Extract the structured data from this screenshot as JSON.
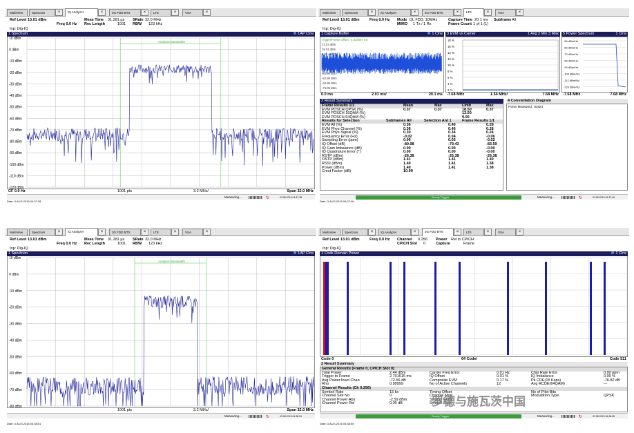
{
  "shots": [
    {
      "tabs": [
        "MultiView",
        "Spectrum",
        "IQ Analyzer",
        "3G FDD BTS",
        "LTE",
        "VSA"
      ],
      "params": {
        "ref_level": "Ref Level 13.01 dBm",
        "meas_time": "Meas Time",
        "meas_time_val": "31.281 µs",
        "srate": "SRate",
        "srate_val": "32.0 MHz",
        "freq": "Freq 0.0 Hz",
        "rec_length": "Rec Length",
        "rec_length_val": "1001",
        "rbw": "RBW",
        "rbw_val": "123 kHz",
        "inp": "Inp: Dig-IQ"
      },
      "window_title": "1 Spectrum",
      "window_flag": "1AP Clrw",
      "annotation": "Analysis Bandwidth",
      "yticks": [
        "10 dBm",
        "0 dBm",
        "-10 dBm",
        "-20 dBm",
        "-30 dBm",
        "-40 dBm",
        "-50 dBm",
        "-60 dBm",
        "-70 dBm",
        "-80 dBm",
        "-90 dBm",
        "-100 dBm",
        "-110 dBm",
        "-120 dBm"
      ],
      "bottom": {
        "left": "CF 0.0 Hz",
        "mid": "1001 pts",
        "mid2": "3.2 MHz/",
        "right": "Span 32.0 MHz"
      },
      "status": "Measuring...",
      "date": "Date: 3.AUG.2015  04:37:38",
      "clock": "03.08.2015 04:37:38"
    },
    {
      "tabs": [
        "MultiView",
        "Spectrum",
        "IQ Analyzer",
        "3G FDD BTS",
        "LTE",
        "VSA"
      ],
      "params": {
        "ref_level": "Ref Level 13.01 dBm",
        "freq": "Freq 0.0 Hz",
        "mode": "Mode",
        "mode_val": "DL FDD, 10MHz",
        "mimo": "MIMO",
        "mimo_val": "1 Tx / 1 Rx",
        "capture_time": "Capture Time",
        "capture_time_val": "20.1 ms",
        "frame_count": "Frame Count",
        "frame_count_val": "1 of 1 (1)",
        "subframe": "Subframe",
        "subframe_val": "All",
        "inp": "Inp: Dig-IQ"
      },
      "capture": {
        "title": "1 Capture Buffer",
        "flag": "1 Clrw",
        "ylabels": [
          "Trigger/Frame Offset: -1.333067 ms",
          "31.01 dBm",
          "19.01 dBm",
          "7.01 dBm",
          "-4.99 dBm",
          "-16.99 dBm",
          "-28.99 dBm",
          "-40.99 dBm",
          "-52.99 dBm",
          "-64.99 dBm",
          "-76.99 dBm"
        ],
        "x0": "0.0 ms",
        "x1": "2.01 ms/",
        "x2": "20.1 ms"
      },
      "evm": {
        "title": "3 EVM vs Carrier",
        "flag": "1 Avg  2 Min  3 Max",
        "ylabels": [
          "18 %",
          "16 %",
          "14 %",
          "12 %",
          "10 %",
          "8 %",
          "6 %",
          "4 %",
          "2 %"
        ],
        "x0": "-7.68 MHz",
        "x1": "1.54 MHz/",
        "x2": "7.68 MHz"
      },
      "ps": {
        "title": "5 Power Spectrum",
        "flag": "1 Clrw",
        "ylabels": [
          "-54 dBm/Hz",
          "-60 dBm/Hz",
          "-70 dBm/Hz",
          "-80 dBm/Hz",
          "-90 dBm/Hz",
          "-100 dBm/Hz",
          "-112 dBm/Hz",
          "-120 dBm/Hz"
        ],
        "x0": "-7.68 MHz",
        "x2": "7.68 MHz"
      },
      "summary": {
        "title": "2 Result Summary",
        "header": [
          "Frame Results 1/1",
          "Mean",
          "Max",
          "Limit",
          "Max"
        ],
        "rows1": [
          [
            "EVM PDSCH QPSK (%)",
            "0.37",
            "0.37",
            "18.50",
            "0.37"
          ],
          [
            "EVM PDSCH 16QAM (%)",
            "",
            "",
            "13.50",
            ""
          ],
          [
            "EVM PDSCH 64QAM (%)",
            "",
            "",
            "9.00",
            ""
          ]
        ],
        "header2": [
          "Results for Selection",
          "Subframes  All",
          "Selection  Ant 1",
          "Frame Results  1/1"
        ],
        "rows2": [
          [
            "EVM All (%)",
            "0.36",
            "0.40",
            "0.28"
          ],
          [
            "EVM Phys Channel (%)",
            "0.36",
            "0.40",
            "0.28"
          ],
          [
            "EVM Phys Signal (%)",
            "0.30",
            "0.34",
            "0.24"
          ],
          [
            "Frequency Error (Hz)",
            "-0.02",
            "0.04",
            "-0.06"
          ],
          [
            "Sampling Error (ppm)",
            "0.00",
            "0.03",
            "-0.02"
          ],
          [
            "IQ Offset (dB)",
            "-80.98",
            "-79.43",
            "-83.59"
          ],
          [
            "IQ Gain Imbalance (dB)",
            "0.00",
            "0.00",
            "-0.00"
          ],
          [
            "IQ Quadrature Error (°)",
            "0.00",
            "0.00",
            "-0.00"
          ],
          [
            "RSTP (dBm)",
            "-26.38",
            "-26.38",
            "-26.38"
          ],
          [
            "OSTP (dBm)",
            "1.41",
            "1.41",
            "1.40"
          ],
          [
            "RSSI (dBm)",
            "1.40",
            "1.41",
            "1.38"
          ],
          [
            "Power (dBm)",
            "1.40",
            "1.41",
            "1.38"
          ],
          [
            "Crest Factor (dB)",
            "10.99",
            "",
            ""
          ]
        ]
      },
      "constellation": {
        "title": "4 Constellation Diagram",
        "note": "Points Measured : 82824"
      },
      "status": "Measuring...",
      "green": "Ready Trigger",
      "date": "Date: 3.AUG.2015  04:37:46",
      "clock": "03.08.2015 04:37:46"
    },
    {
      "tabs": [
        "MultiView",
        "Spectrum",
        "IQ Analyzer",
        "3G FDD BTS",
        "LTE",
        "VSA"
      ],
      "params": {
        "ref_level": "Ref Level 13.01 dBm",
        "meas_time": "Meas Time",
        "meas_time_val": "31.281 µs",
        "srate": "SRate",
        "srate_val": "32.0 MHz",
        "freq": "Freq 0.0 Hz",
        "rec_length": "Rec Length",
        "rec_length_val": "1001",
        "rbw": "RBW",
        "rbw_val": "123 kHz",
        "inp": "Inp: Dig-IQ"
      },
      "window_title": "1 Spectrum",
      "window_flag": "1AP Clrw",
      "annotation": "Analysis Bandwidth",
      "yticks": [
        "10 dBm",
        "0 dBm",
        "-10 dBm",
        "-20 dBm",
        "-30 dBm",
        "-40 dBm",
        "-50 dBm",
        "-60 dBm",
        "-70 dBm",
        "-80 dBm"
      ],
      "bottom": {
        "left": "",
        "mid": "1001 pts",
        "mid2": "3.2 MHz/",
        "right": "Span 32.0 MHz"
      },
      "status": "Measuring...",
      "date": "Date: 3.AUG.2015  04:38:51",
      "clock": "03.08.2015 04:38:51"
    },
    {
      "tabs": [
        "MultiView",
        "Spectrum",
        "IQ Analyzer",
        "3G FDD BTS",
        "LTE",
        "VSA"
      ],
      "params": {
        "ref_level": "Ref Level 13.01 dBm",
        "freq": "Freq 0.0 Hz",
        "channel": "Channel",
        "channel_val": "0.256",
        "power": "Power",
        "power_val": "Rel to CPICH",
        "cpich": "CPICH Slot",
        "cpich_val": "0",
        "capture": "Capture",
        "capture_val": "Frame",
        "inp": "Inp: Dig-IQ"
      },
      "cdp": {
        "title": "1 Code Domain Power",
        "flag": "1 Clrw",
        "x0": "Code 0",
        "x1": "64 Code/",
        "x2": "Code 511"
      },
      "summary": {
        "title": "2 Result Summary",
        "general": "General Results (Frame 0, CPICH Slot 0)",
        "grows": [
          [
            "Total Power",
            "2.44 dBm",
            "Carrier Freq Error",
            "0.01 Hz",
            "Chip Rate Error",
            "0.00 ppm"
          ],
          [
            "Trigger to Frame",
            "2.701615 ms",
            "IQ Offset",
            "0.01 %",
            "IQ Imbalance",
            "0.00 %"
          ],
          [
            "Avg Power Inact Chan",
            "-72.56 dB",
            "Composite EVM",
            "0.17 %",
            "Pk CDE(15 Ksps)",
            "-76.82 dB"
          ],
          [
            "Rho",
            "0.99999",
            "No of Active Channels",
            "12",
            "Avg RCDE(64QAM)",
            "---"
          ]
        ],
        "channel": "Channel Results (Ch 0.256)",
        "crows": [
          [
            "Symbol Rate",
            "15 ks",
            "Timing Offset",
            "",
            "No of Pilot Bits",
            ""
          ],
          [
            "Channel Slot No",
            "0",
            "Channel Mod.",
            "",
            "Modulation Type",
            "QPSK"
          ],
          [
            "Channel Power Abs",
            "-2.59 dBm",
            "Symbol EVM",
            "",
            "",
            ""
          ],
          [
            "Channel Power Rel",
            "0.00 dB",
            "Symbol EVM",
            "",
            "",
            ""
          ]
        ]
      },
      "status": "Measuring...",
      "green": "Ready Trigger",
      "date": "Date: 3.AUG.2015  04:38:55",
      "clock": "03.08.2015 04:38:55"
    }
  ],
  "watermark": "罗德与施瓦茨中国",
  "chart_data": [
    {
      "type": "line",
      "title": "1 Spectrum",
      "xlabel": "",
      "ylabel": "",
      "xlim": [
        -16,
        16
      ],
      "ylim": [
        -120,
        10
      ],
      "series": [
        {
          "name": "1AP Clrw",
          "x": [
            -16,
            -12,
            -8,
            -5,
            -4.6,
            -4.6,
            0,
            4.6,
            4.6,
            8,
            12,
            16
          ],
          "values": [
            -80,
            -78,
            -77,
            -72,
            -72,
            -18,
            -17,
            -18,
            -75,
            -78,
            -80,
            -85
          ]
        }
      ]
    },
    {
      "type": "bar",
      "title": "1 Code Domain Power",
      "xlabel": "",
      "ylabel": "",
      "categories": [
        "Code 0",
        "Code 511"
      ],
      "series": [
        {
          "name": "1 Clrw",
          "values": [
            0,
            0
          ]
        }
      ]
    }
  ]
}
